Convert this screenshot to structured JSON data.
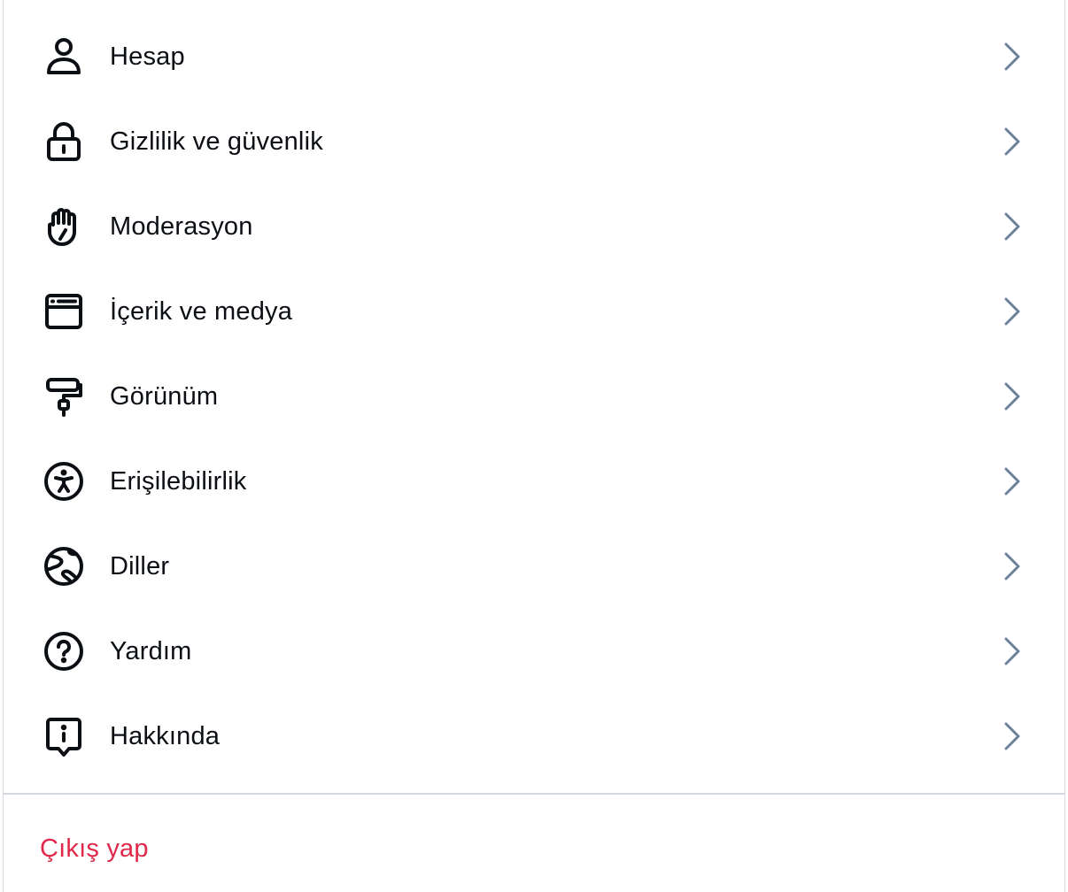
{
  "menu": {
    "items": [
      {
        "label": "Hesap",
        "icon": "person-icon"
      },
      {
        "label": "Gizlilik ve güvenlik",
        "icon": "lock-icon"
      },
      {
        "label": "Moderasyon",
        "icon": "raised-hand-icon"
      },
      {
        "label": "İçerik ve medya",
        "icon": "window-icon"
      },
      {
        "label": "Görünüm",
        "icon": "paint-roller-icon"
      },
      {
        "label": "Erişilebilirlik",
        "icon": "accessibility-icon"
      },
      {
        "label": "Diller",
        "icon": "globe-icon"
      },
      {
        "label": "Yardım",
        "icon": "question-circle-icon"
      },
      {
        "label": "Hakkında",
        "icon": "info-bubble-icon"
      }
    ]
  },
  "footer": {
    "signout_label": "Çıkış yap"
  },
  "colors": {
    "text": "#0b0f14",
    "chevron": "#6f829c",
    "divider": "#d4d9e1",
    "signout": "#e0284a"
  }
}
